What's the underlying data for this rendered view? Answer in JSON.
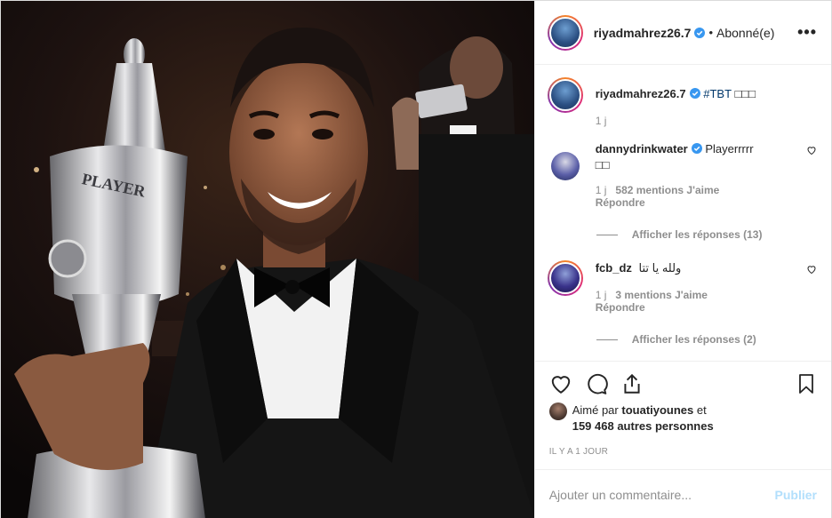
{
  "post": {
    "author": "riyadmahrez26.7",
    "follow_state": "Abonné(e)",
    "dot": "•",
    "more": "•••",
    "caption": {
      "username": "riyadmahrez26.7",
      "text": "#TBT",
      "emoji": "□□□",
      "time": "1 j"
    },
    "comments": [
      {
        "username": "dannydrinkwater",
        "text": "Playerrrrr",
        "emoji": "□□",
        "time": "1 j",
        "likes": "582 mentions J'aime",
        "reply": "Répondre",
        "show_replies": "Afficher les réponses (13)"
      },
      {
        "username": "fcb_dz",
        "text": "ولله يا تتا",
        "time": "1 j",
        "likes": "3 mentions J'aime",
        "reply": "Répondre",
        "show_replies": "Afficher les réponses (2)"
      }
    ],
    "liked_by": {
      "prefix": "Aimé par",
      "user": "touatiyounes",
      "suffix": "et",
      "count": "159 468 autres personnes"
    },
    "posted_time": "IL Y A 1 JOUR",
    "add_comment_placeholder": "Ajouter un commentaire...",
    "publish_label": "Publier"
  },
  "photo": {
    "trophy_text": "PLAYER"
  },
  "colors": {
    "accent": "#0095f6",
    "verified": "#3897f0",
    "muted": "#8e8e8e",
    "publish_disabled": "#b2dffc"
  },
  "icons": [
    "heart-icon",
    "comment-icon",
    "share-icon",
    "bookmark-icon",
    "verified-icon",
    "more-icon"
  ]
}
